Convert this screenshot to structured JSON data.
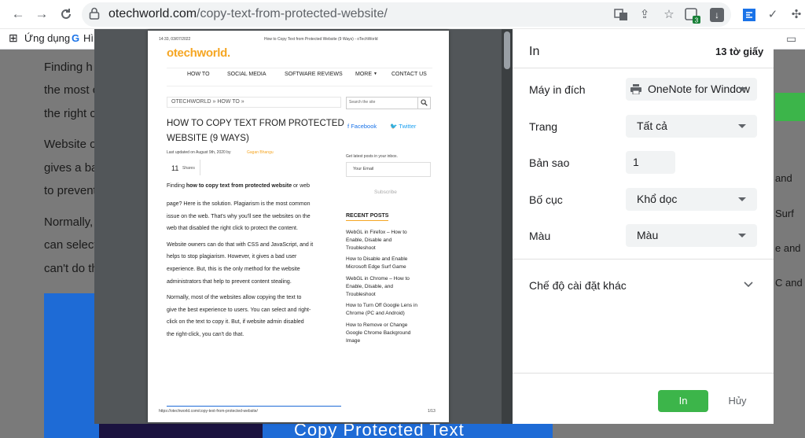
{
  "browser": {
    "url_domain": "otechworld.com",
    "url_path": "/copy-text-from-protected-website/",
    "bookmarks": [
      "Ứng dụng",
      "Hì"
    ]
  },
  "background_page": {
    "lines": [
      "Finding h",
      "the most c",
      "the right c",
      "Website o",
      "gives a ba",
      "to prevent",
      "Normally,",
      "can select",
      "can't do th"
    ],
    "right_fragments": [
      "and",
      "Surf",
      "e and",
      "C and"
    ],
    "image_text": "Copy Protected Text"
  },
  "preview": {
    "header_left": "14:33, 03/07/2022",
    "header_center": "How to Copy Text from Protected Website (9 Ways) - oTechWorld",
    "logo": "otechworld.",
    "nav": [
      "HOW TO",
      "SOCIAL MEDIA",
      "SOFTWARE REVIEWS",
      "MORE",
      "CONTACT US"
    ],
    "breadcrumb": "OTECHWORLD » HOW TO »",
    "search_placeholder": "Search the site",
    "title_line1": "HOW TO COPY TEXT FROM PROTECTED",
    "title_line2": "WEBSITE (9 WAYS)",
    "updated": "Last updated on August 9th, 2020  by",
    "author": "Gagan Bhangu",
    "shares_count": "11",
    "shares_label": "Shares",
    "facebook": "Facebook",
    "twitter": "Twitter",
    "newsletter": "Get latest posts in your inbox.",
    "email_placeholder": "Your Email",
    "subscribe": "Subscribe",
    "recent_heading": "RECENT POSTS",
    "recent_posts": [
      [
        "WebGL in Firefox – How to",
        "Enable, Disable and",
        "Troubleshoot"
      ],
      [
        "How to Disable and Enable",
        "Microsoft Edge Surf Game"
      ],
      [
        "WebGL in Chrome – How to",
        "Enable, Disable, and",
        "Troubleshoot"
      ],
      [
        "How to Turn Off Google Lens in",
        "Chrome (PC and Android)"
      ],
      [
        "How to Remove or Change",
        "Google Chrome Background",
        "Image"
      ]
    ],
    "p1_pre": "Finding ",
    "p1_bold": "how to copy text from protected website",
    "p1_post": " or web",
    "body_lines": [
      "page? Here is the solution. Plagiarism is the most common",
      "issue on the web. That's why you'll see the websites on the",
      "web that disabled the right click to protect the content.",
      "",
      "Website owners can do that with CSS and JavaScript, and it",
      "helps to stop plagiarism. However, it gives a bad user",
      "experience. But, this is the only method for the website",
      "administrators that help to prevent content stealing.",
      "",
      "Normally, most of the websites allow copying the text to",
      "give the best experience to users. You can select and right-",
      "click on the text to copy it. But, if website admin disabled",
      "the right-click, you can't do that."
    ],
    "footer_url": "https://otechworld.com/copy-text-from-protected-website/",
    "footer_page": "1/13"
  },
  "print_panel": {
    "title": "In",
    "sheets": "13 tờ giấy",
    "destination_label": "Máy in đích",
    "destination_value": "OneNote for Window",
    "pages_label": "Trang",
    "pages_value": "Tất cả",
    "copies_label": "Bản sao",
    "copies_value": "1",
    "layout_label": "Bố cục",
    "layout_value": "Khổ dọc",
    "color_label": "Màu",
    "color_value": "Màu",
    "more_settings": "Chế độ cài đặt khác",
    "print_button": "In",
    "cancel_button": "Hủy"
  },
  "colors": {
    "accent_green": "#3cb54a",
    "brand_orange": "#f5a623"
  }
}
